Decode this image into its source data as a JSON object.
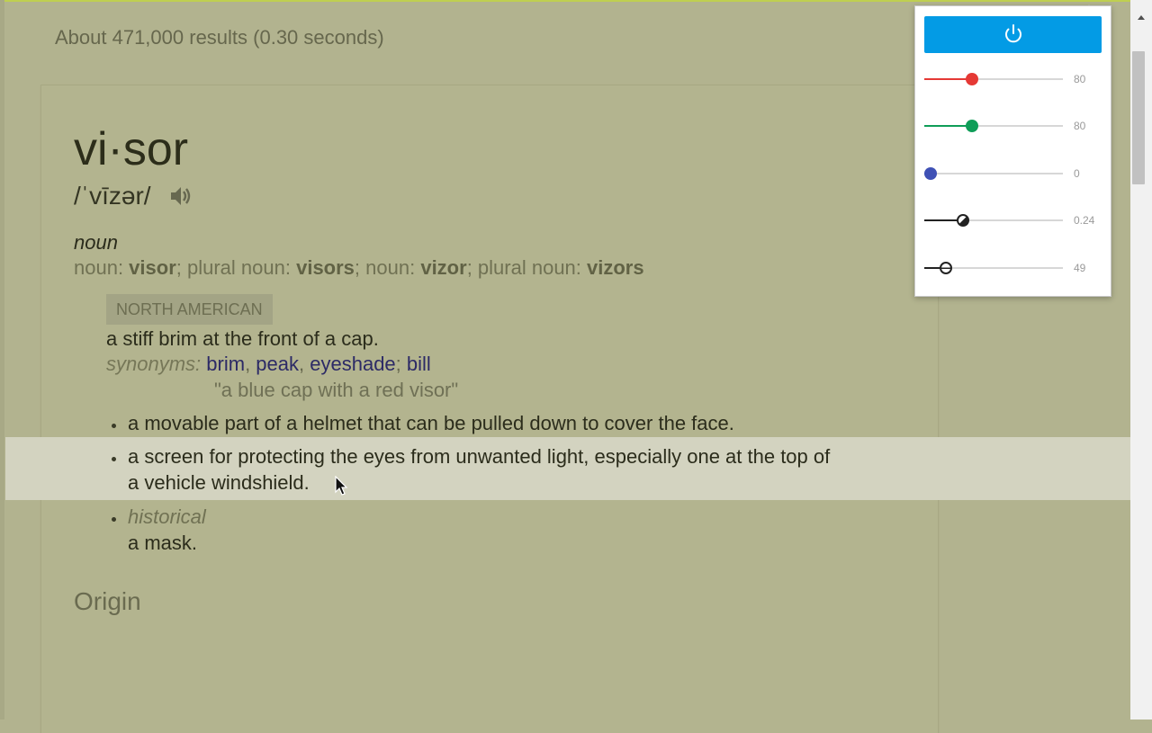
{
  "results_stats": "About 471,000 results (0.30 seconds)",
  "entry": {
    "word": "vi·sor",
    "pronunciation": "/ˈvīzər/",
    "part_of_speech": "noun",
    "forms": [
      {
        "prefix": "noun: ",
        "word": "visor",
        "sep": "; "
      },
      {
        "prefix": "plural noun: ",
        "word": "visors",
        "sep": "; "
      },
      {
        "prefix": "noun: ",
        "word": "vizor",
        "sep": "; "
      },
      {
        "prefix": "plural noun: ",
        "word": "vizors",
        "sep": ""
      }
    ],
    "region_label": "NORTH AMERICAN",
    "definition_1": "a stiff brim at the front of a cap.",
    "synonyms_label": "synonyms:",
    "synonyms": [
      "brim",
      "peak",
      "eyeshade",
      "bill"
    ],
    "synonym_separators": [
      ", ",
      ", ",
      "; "
    ],
    "example": "\"a blue cap with a red visor\"",
    "definition_2": "a movable part of a helmet that can be pulled down to cover the face.",
    "definition_3_line1": "a screen for protecting the eyes from unwanted light, especially one at the top of",
    "definition_3_line2": "a vehicle windshield.",
    "historical_label": "historical",
    "definition_4": "a mask.",
    "origin_heading": "Origin"
  },
  "icons": {
    "speaker": "speaker-icon",
    "power": "power-icon",
    "cursor": "mouse-cursor-icon"
  },
  "popup": {
    "sliders": [
      {
        "name": "red",
        "value": "80",
        "color": "#e53935",
        "level": 0.33
      },
      {
        "name": "green",
        "value": "80",
        "color": "#0f9d58",
        "level": 0.33
      },
      {
        "name": "blue",
        "value": "0",
        "color": "#3f51b5",
        "level": 0.0
      },
      {
        "name": "contrast",
        "value": "0.24",
        "color": "#222222",
        "level": 0.26
      },
      {
        "name": "brightness",
        "value": "49",
        "color": "#222222",
        "level": 0.12
      }
    ],
    "power_color": "#039be5"
  },
  "colors": {
    "page_background": "#b2b38f",
    "highlight_row": "#d3d3c0",
    "link": "#2c2a66"
  }
}
